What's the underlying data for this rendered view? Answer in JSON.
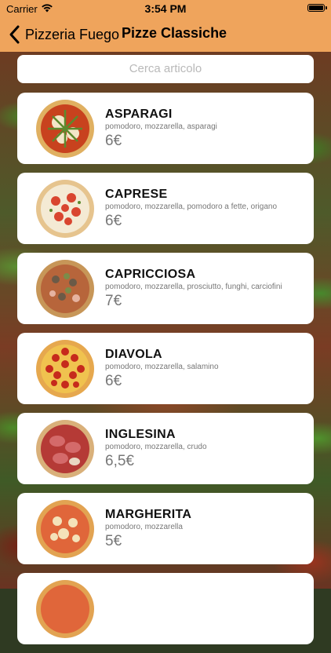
{
  "status_bar": {
    "carrier": "Carrier",
    "time": "3:54 PM"
  },
  "nav": {
    "back_label": "Pizzeria Fuego",
    "title": "Pizze Classiche"
  },
  "search": {
    "placeholder": "Cerca articolo"
  },
  "items": [
    {
      "name": "ASPARAGI",
      "ingredients": "pomodoro, mozzarella, asparagi",
      "price": "6€"
    },
    {
      "name": "CAPRESE",
      "ingredients": "pomodoro, mozzarella, pomodoro a fette, origano",
      "price": "6€"
    },
    {
      "name": "CAPRICCIOSA",
      "ingredients": "pomodoro, mozzarella, prosciutto, funghi, carciofini",
      "price": "7€"
    },
    {
      "name": "DIAVOLA",
      "ingredients": "pomodoro, mozzarella, salamino",
      "price": "6€"
    },
    {
      "name": "INGLESINA",
      "ingredients": "pomodoro, mozzarella, crudo",
      "price": "6,5€"
    },
    {
      "name": "MARGHERITA",
      "ingredients": "pomodoro, mozzarella",
      "price": "5€"
    }
  ],
  "colors": {
    "accent": "#efa45c",
    "card": "#ffffff",
    "text_muted": "#777777"
  }
}
